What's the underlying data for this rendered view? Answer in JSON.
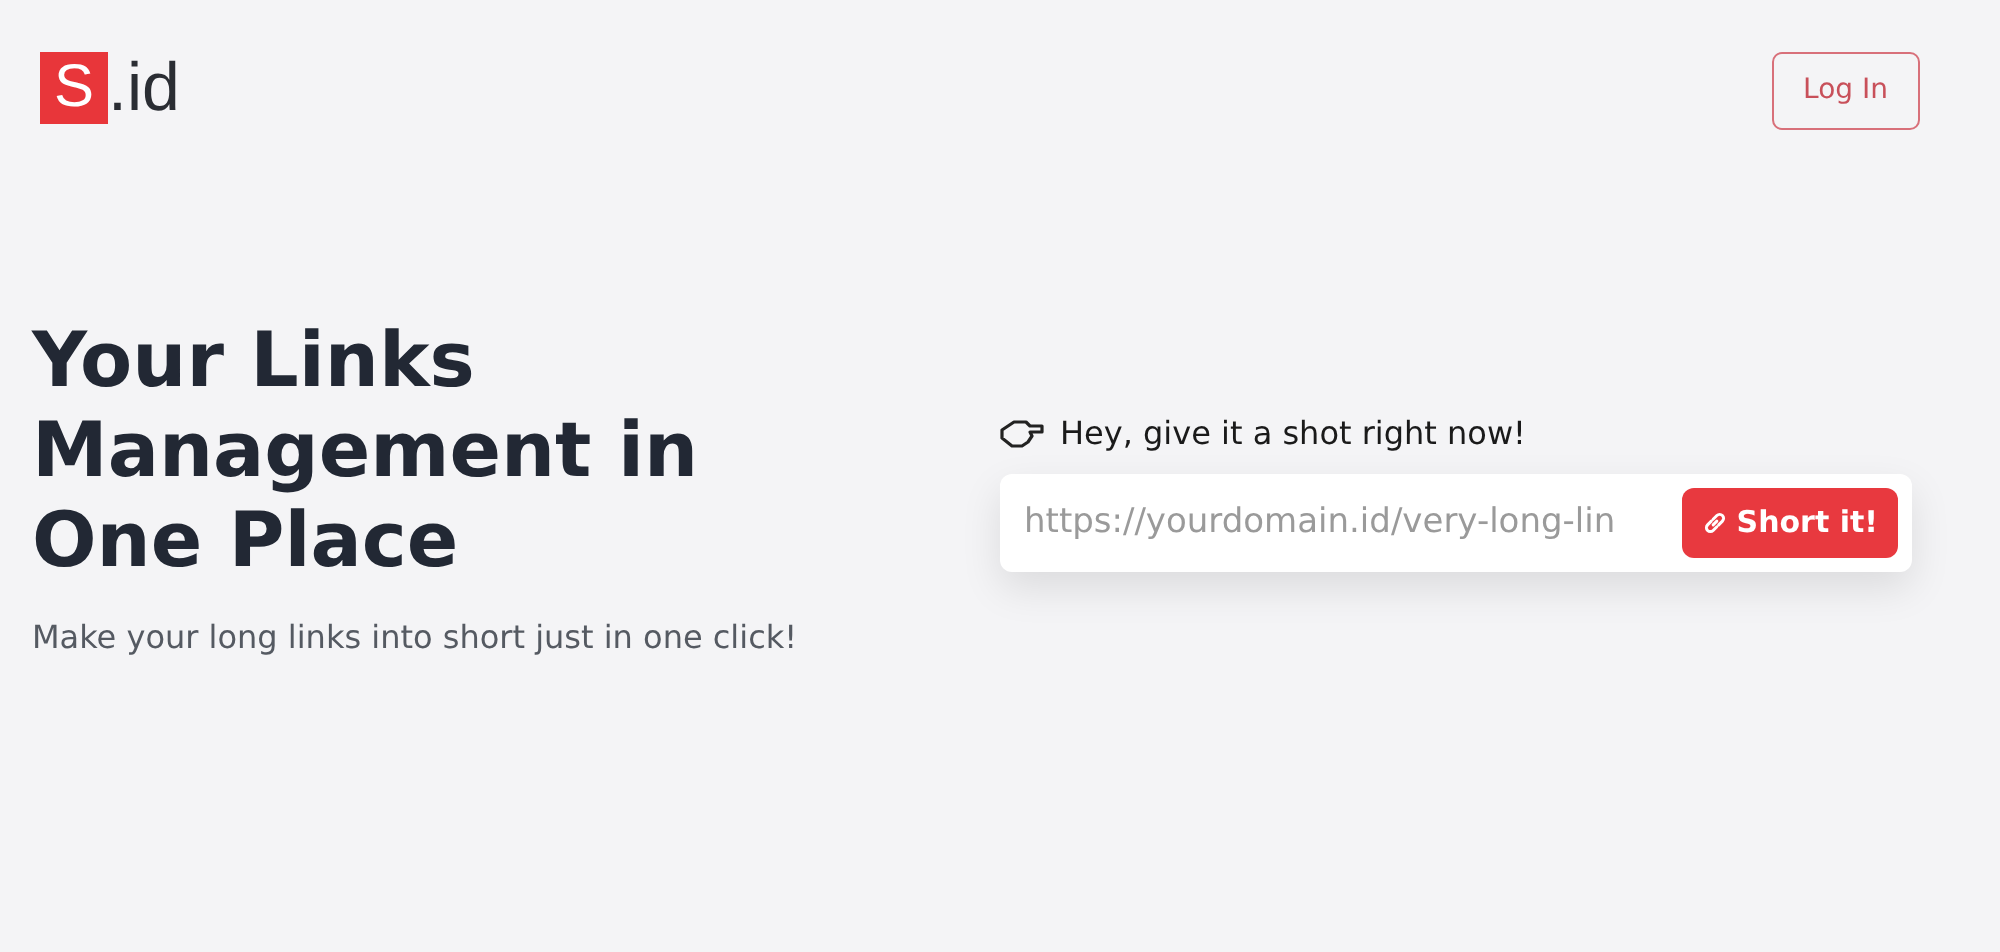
{
  "logo": {
    "mark": "S",
    "text": ".id"
  },
  "login_button": {
    "label": "Log In"
  },
  "hero": {
    "title_lines": [
      "Your Links",
      "Management in",
      "One Place"
    ],
    "subtitle": "Make your long links into short just in one click!"
  },
  "shortener": {
    "prompt": "Hey, give it a shot right now!",
    "placeholder": "https://yourdomain.id/very-long-lin",
    "button": "Short it!"
  }
}
